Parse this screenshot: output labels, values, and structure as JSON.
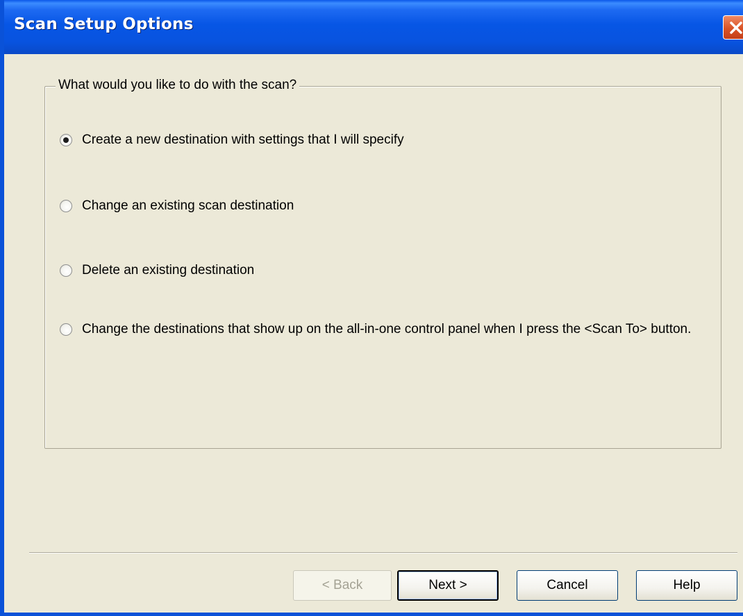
{
  "window": {
    "title": "Scan Setup Options"
  },
  "group": {
    "label": "What would you like to do with the scan?"
  },
  "options": [
    {
      "label": "Create a new destination with settings that I will specify",
      "checked": true
    },
    {
      "label": "Change an existing scan destination",
      "checked": false
    },
    {
      "label": "Delete an existing destination",
      "checked": false
    },
    {
      "label": "Change the destinations that show up on the all-in-one control panel when I press the <Scan To> button.",
      "checked": false
    }
  ],
  "buttons": {
    "back": "< Back",
    "next": "Next >",
    "cancel": "Cancel",
    "help": "Help"
  },
  "colors": {
    "titlebar": "#0A52D8",
    "dialog_bg": "#ECE9D8",
    "close_button": "#D95326"
  },
  "icons": {
    "close": "close-icon"
  }
}
